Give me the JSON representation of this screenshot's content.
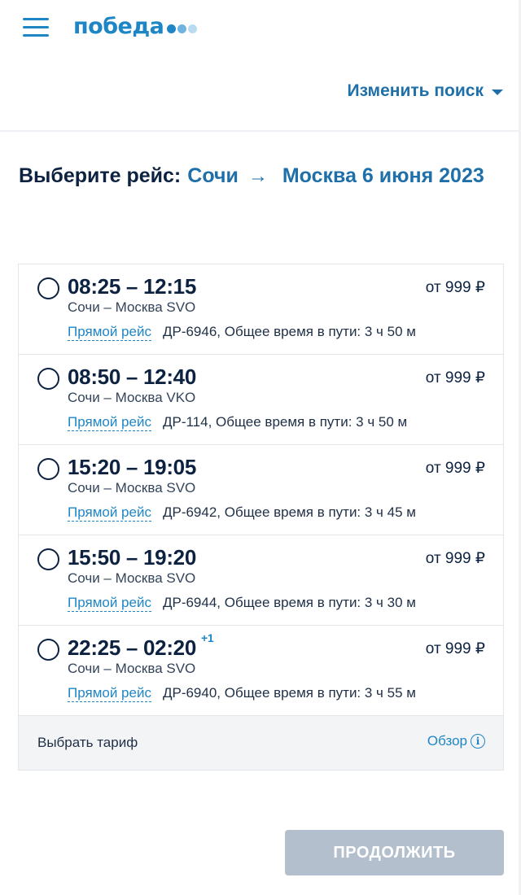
{
  "header": {
    "logo_text": "победа",
    "logo_dot_colors": [
      "#1f86c6",
      "#6fb3e0",
      "#b9dbf2"
    ],
    "change_search_label": "Изменить поиск"
  },
  "title": {
    "label": "Выберите рейс:",
    "origin": "Сочи",
    "arrow": "→",
    "destination_date": "Москва 6 июня 2023"
  },
  "flights": [
    {
      "times": "08:25 – 12:15",
      "next_day": "",
      "price": "от 999 ₽",
      "route": "Сочи – Москва SVO",
      "direct_label": "Прямой рейс",
      "info": "ДР-6946, Общее время в пути: 3 ч 50 м"
    },
    {
      "times": "08:50 – 12:40",
      "next_day": "",
      "price": "от 999 ₽",
      "route": "Сочи – Москва VKO",
      "direct_label": "Прямой рейс",
      "info": "ДР-114, Общее время в пути: 3 ч 50 м"
    },
    {
      "times": "15:20 – 19:05",
      "next_day": "",
      "price": "от 999 ₽",
      "route": "Сочи – Москва SVO",
      "direct_label": "Прямой рейс",
      "info": "ДР-6942, Общее время в пути: 3 ч 45 м"
    },
    {
      "times": "15:50 – 19:20",
      "next_day": "",
      "price": "от 999 ₽",
      "route": "Сочи – Москва SVO",
      "direct_label": "Прямой рейс",
      "info": "ДР-6944, Общее время в пути: 3 ч 30 м"
    },
    {
      "times": "22:25 – 02:20",
      "next_day": "+1",
      "price": "от 999 ₽",
      "route": "Сочи – Москва SVO",
      "direct_label": "Прямой рейс",
      "info": "ДР-6940, Общее время в пути: 3 ч 55 м"
    }
  ],
  "tariff": {
    "label": "Выбрать тариф",
    "overview_label": "Обзор",
    "info_glyph": "i"
  },
  "continue_label": "ПРОДОЛЖИТЬ",
  "colors": {
    "brand_blue": "#1f86c6",
    "link_blue": "#1f6fa8",
    "text_navy": "#0d2240",
    "disabled_button": "#b3bfcd"
  }
}
